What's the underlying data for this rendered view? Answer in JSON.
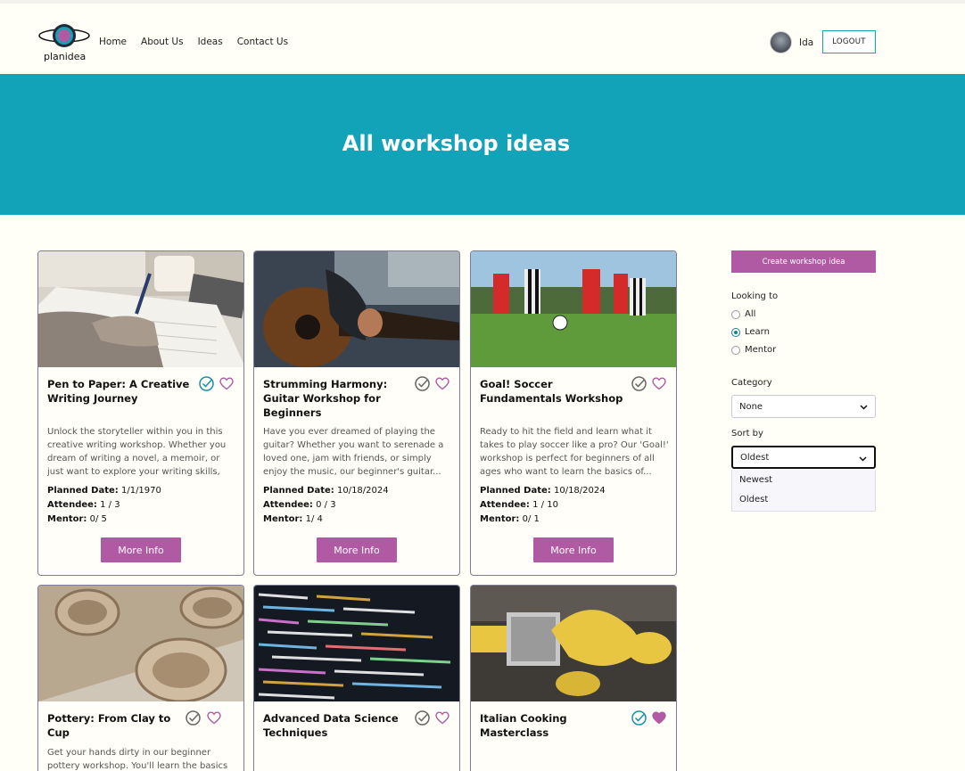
{
  "header": {
    "logo_text": "planidea",
    "nav": [
      "Home",
      "About Us",
      "Ideas",
      "Contact Us"
    ],
    "username": "Ida",
    "logout_label": "LOGOUT"
  },
  "hero": {
    "title": "All workshop ideas"
  },
  "cards": [
    {
      "title": "Pen to Paper: A Creative Writing Journey",
      "description": "Unlock the storyteller within you in this creative writing workshop. Whether you dream of writing a novel, a memoir, or just want to explore your writing skills, this...",
      "planned_date_label": "Planned Date:",
      "planned_date": "1/1/1970",
      "attendee_label": "Attendee:",
      "attendee": "1 / 3",
      "mentor_label": "Mentor:",
      "mentor": "0/ 5",
      "button": "More Info",
      "check_color": "#1a8fa3",
      "heart_filled": false
    },
    {
      "title": "Strumming Harmony: Guitar Workshop for Beginners",
      "description": "Have you ever dreamed of playing the guitar? Whether you want to serenade a loved one, jam with friends, or simply enjoy the music, our beginner's guitar...",
      "planned_date_label": "Planned Date:",
      "planned_date": "10/18/2024",
      "attendee_label": "Attendee:",
      "attendee": "0 / 3",
      "mentor_label": "Mentor:",
      "mentor": "1/ 4",
      "button": "More Info",
      "check_color": "#666666",
      "heart_filled": false
    },
    {
      "title": "Goal! Soccer Fundamentals Workshop",
      "description": "Ready to hit the field and learn what it takes to play soccer like a pro? Our 'Goal!' workshop is perfect for beginners of all ages who want to learn the basics of...",
      "planned_date_label": "Planned Date:",
      "planned_date": "10/18/2024",
      "attendee_label": "Attendee:",
      "attendee": "1 / 10",
      "mentor_label": "Mentor:",
      "mentor": "0/ 1",
      "button": "More Info",
      "check_color": "#666666",
      "heart_filled": false
    },
    {
      "title": "Pottery: From Clay to Cup",
      "description": "Get your hands dirty in our beginner pottery workshop. You'll learn the basics",
      "check_color": "#666666",
      "heart_filled": false
    },
    {
      "title": "Advanced Data Science Techniques",
      "description": "",
      "check_color": "#666666",
      "heart_filled": false
    },
    {
      "title": "Italian Cooking Masterclass",
      "description": "",
      "check_color": "#1a8fa3",
      "heart_filled": true
    }
  ],
  "sidebar": {
    "create_label": "Create workshop idea",
    "looking_label": "Looking to",
    "looking_options": [
      "All",
      "Learn",
      "Mentor"
    ],
    "looking_selected": "Learn",
    "category_label": "Category",
    "category_value": "None",
    "sort_label": "Sort by",
    "sort_value": "Oldest",
    "sort_options": [
      "Newest",
      "Oldest"
    ]
  },
  "colors": {
    "teal": "#12a3b8",
    "accent": "#b05aa3",
    "background": "#fffef7"
  }
}
